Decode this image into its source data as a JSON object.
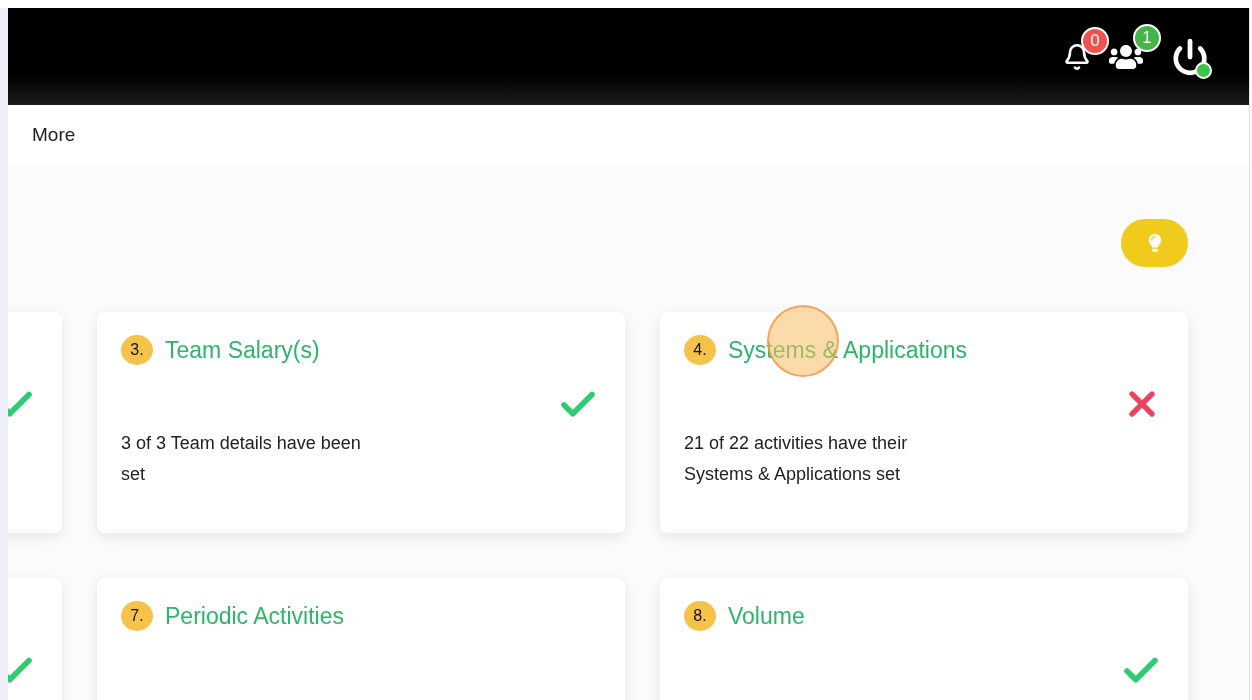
{
  "header": {
    "notifications": {
      "count": "0"
    },
    "contacts": {
      "count": "1"
    },
    "power": {
      "online": true
    }
  },
  "nav": {
    "items": [
      {
        "label": "More"
      }
    ]
  },
  "card_rows": [
    {
      "cards": [
        {
          "kind": "partial",
          "complete": true
        },
        {
          "kind": "full",
          "number": "3.",
          "title": "Team Salary(s)",
          "complete": true,
          "description": "3 of 3 Team details have been set"
        },
        {
          "kind": "full",
          "number": "4.",
          "title": "Systems & Applications",
          "complete": false,
          "description": "21 of 22 activities have their Systems & Applications set"
        }
      ]
    },
    {
      "cards": [
        {
          "kind": "partial",
          "complete": true
        },
        {
          "kind": "full",
          "number": "7.",
          "title": "Periodic Activities"
        },
        {
          "kind": "full",
          "number": "8.",
          "title": "Volume",
          "complete": true
        }
      ]
    }
  ]
}
